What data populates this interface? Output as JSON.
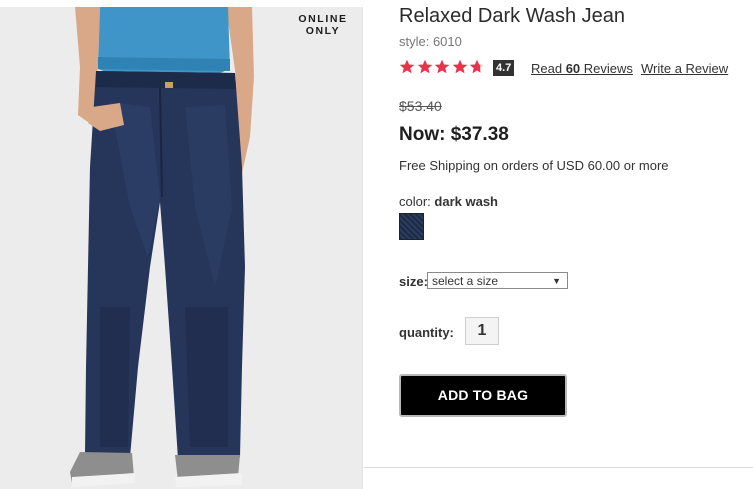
{
  "image": {
    "badge_line1": "ONLINE",
    "badge_line2": "ONLY"
  },
  "product": {
    "title": "Relaxed Dark Wash Jean",
    "style": "style: 6010",
    "rating": 4.7,
    "rating_text": "4.7",
    "reviews_prefix": "Read ",
    "reviews_count": "60",
    "reviews_suffix": " Reviews",
    "write_review": "Write a Review",
    "was_price": "$53.40",
    "now_price": "Now: $37.38",
    "shipping": "Free Shipping on orders of USD 60.00 or more",
    "color_label": "color: ",
    "color_value": "dark wash",
    "size_label": "size:",
    "size_placeholder": "select a size",
    "quantity_label": "quantity:",
    "quantity": "1",
    "add_to_bag": "ADD TO BAG"
  },
  "colors": {
    "star": "#e8334a",
    "swatch": "#1c2a45",
    "button": "#000000"
  }
}
